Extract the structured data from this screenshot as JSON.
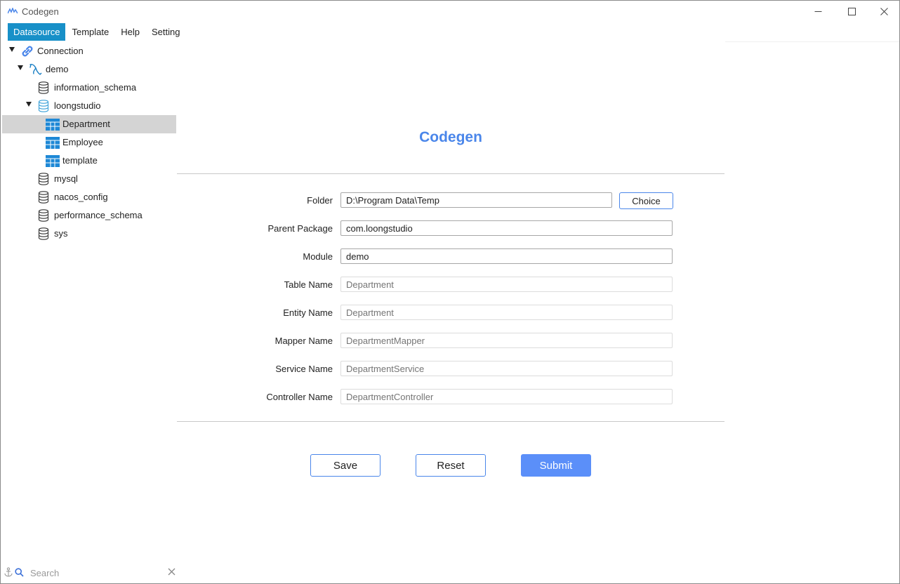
{
  "window": {
    "title": "Codegen"
  },
  "menu": [
    "Datasource",
    "Template",
    "Help",
    "Setting"
  ],
  "tree": {
    "connection": "Connection",
    "server": "demo",
    "databases": {
      "information_schema": "information_schema",
      "loongstudio": "loongstudio",
      "mysql": "mysql",
      "nacos_config": "nacos_config",
      "performance_schema": "performance_schema",
      "sys": "sys"
    },
    "tables": [
      "Department",
      "Employee",
      "template"
    ],
    "selected_table": "Department"
  },
  "search": {
    "placeholder": "Search"
  },
  "form": {
    "title": "Codegen",
    "folder": {
      "label": "Folder",
      "value": "D:\\Program Data\\Temp",
      "button": "Choice"
    },
    "parent_package": {
      "label": "Parent Package",
      "value": "com.loongstudio"
    },
    "module": {
      "label": "Module",
      "value": "demo"
    },
    "table_name": {
      "label": "Table Name",
      "placeholder": "Department"
    },
    "entity_name": {
      "label": "Entity Name",
      "placeholder": "Department"
    },
    "mapper_name": {
      "label": "Mapper Name",
      "placeholder": "DepartmentMapper"
    },
    "service_name": {
      "label": "Service Name",
      "placeholder": "DepartmentService"
    },
    "controller_name": {
      "label": "Controller Name",
      "placeholder": "DepartmentController"
    }
  },
  "actions": {
    "save": "Save",
    "reset": "Reset",
    "submit": "Submit"
  },
  "colors": {
    "menu_active": "#1890c8",
    "accent": "#4a86ea",
    "primary_button": "#5b8ff9",
    "selection": "#d4d4d4",
    "table_icon": "#1e88d6",
    "db_icon_active": "#3aa0d8"
  },
  "icons": {
    "connection": "link-icon",
    "server": "mysql-dolphin-icon",
    "database": "database-icon",
    "table": "table-icon"
  }
}
